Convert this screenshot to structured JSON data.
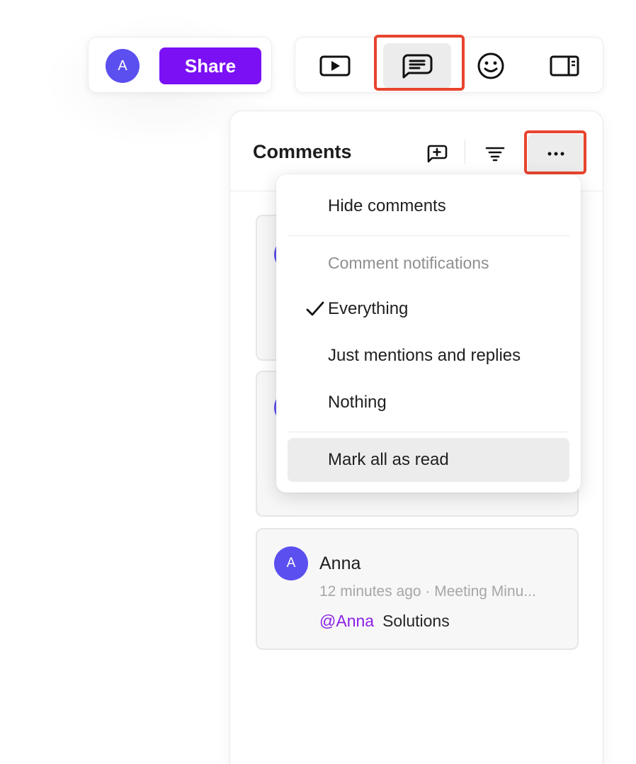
{
  "header": {
    "avatar_initial": "A",
    "share_label": "Share"
  },
  "toolbar": {
    "buttons": [
      {
        "icon": "play-icon",
        "active": false
      },
      {
        "icon": "comments-icon",
        "active": true
      },
      {
        "icon": "emoji-icon",
        "active": false
      },
      {
        "icon": "sidebar-icon",
        "active": false
      }
    ]
  },
  "panel": {
    "title": "Comments"
  },
  "menu": {
    "hide_comments": "Hide comments",
    "section_label": "Comment notifications",
    "options": [
      {
        "label": "Everything",
        "checked": true
      },
      {
        "label": "Just mentions and replies",
        "checked": false
      },
      {
        "label": "Nothing",
        "checked": false
      }
    ],
    "mark_all_read": "Mark all as read"
  },
  "comments": [
    {
      "avatar_initial": "A",
      "author": "Anna",
      "meta": "12 minutes ago · Meeting Minu...",
      "mention": "@Anna",
      "text": "Solutions"
    }
  ],
  "colors": {
    "brand": "#7b10f5",
    "avatar": "#5b4ff0",
    "mention": "#8a1fe8",
    "highlight": "#e8442e"
  }
}
